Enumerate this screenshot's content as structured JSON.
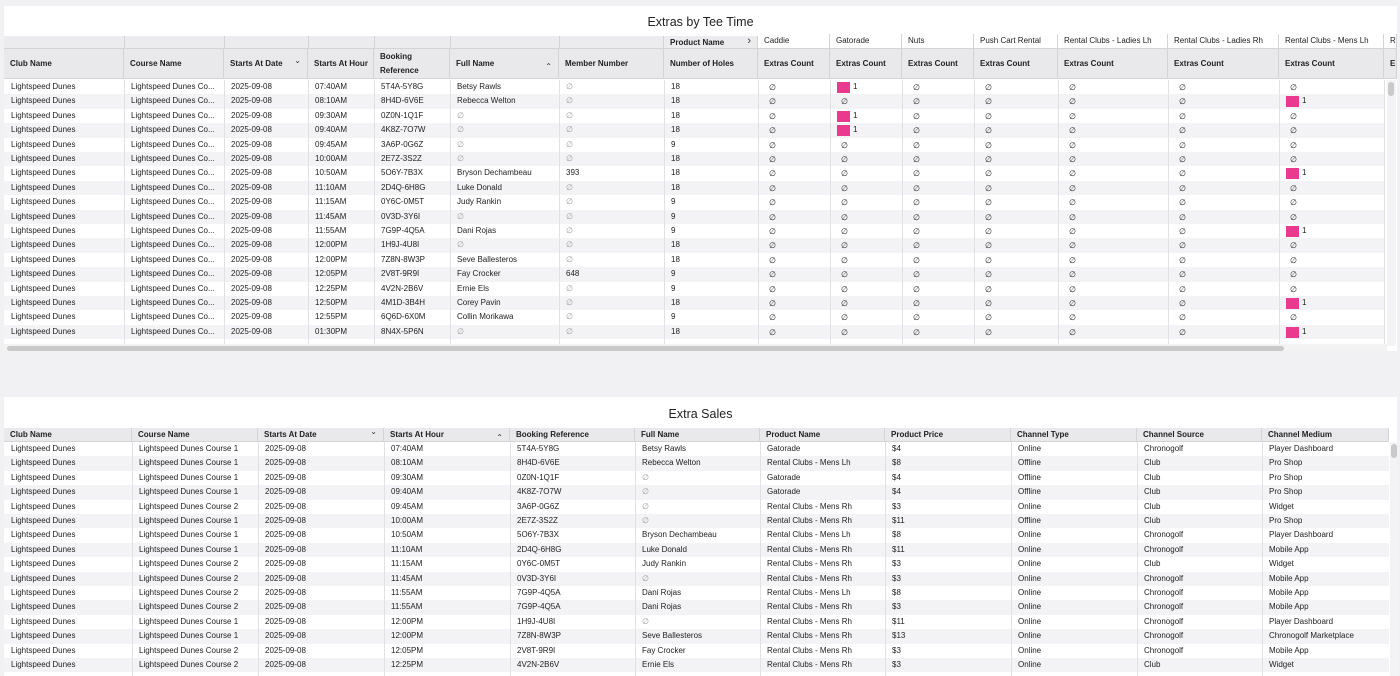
{
  "table1": {
    "title": "Extras by Tee Time",
    "pivot_label": "Product Name",
    "pivot_chevron": "›",
    "columns": [
      "Club Name",
      "Course Name",
      "Starts At Date",
      "Starts At Hour",
      "Booking Reference",
      "Full Name",
      "Member Number",
      "Number of Holes"
    ],
    "booking_line1": "Booking",
    "booking_line2": "Reference",
    "product_groups": [
      "Caddie",
      "Gatorade",
      "Nuts",
      "Push Cart Rental",
      "Rental Clubs - Ladies Lh",
      "Rental Clubs - Ladies Rh",
      "Rental Clubs - Mens Lh",
      "R"
    ],
    "measure_label": "Extras Count",
    "measure_partial": "E",
    "null_symbol": "∅",
    "sort_desc_icon": "⌄",
    "sort_asc_icon": "⌃",
    "rows": [
      [
        "Lightspeed Dunes",
        "Lightspeed Dunes Co...",
        "2025-09-08",
        "07:40AM",
        "5T4A-5Y8G",
        "Betsy Rawls",
        "",
        "18"
      ],
      [
        "Lightspeed Dunes",
        "Lightspeed Dunes Co...",
        "2025-09-08",
        "08:10AM",
        "8H4D-6V6E",
        "Rebecca Welton",
        "",
        "18"
      ],
      [
        "Lightspeed Dunes",
        "Lightspeed Dunes Co...",
        "2025-09-08",
        "09:30AM",
        "0Z0N-1Q1F",
        "",
        "",
        "18"
      ],
      [
        "Lightspeed Dunes",
        "Lightspeed Dunes Co...",
        "2025-09-08",
        "09:40AM",
        "4K8Z-7O7W",
        "",
        "",
        "18"
      ],
      [
        "Lightspeed Dunes",
        "Lightspeed Dunes Co...",
        "2025-09-08",
        "09:45AM",
        "3A6P-0G6Z",
        "",
        "",
        "9"
      ],
      [
        "Lightspeed Dunes",
        "Lightspeed Dunes Co...",
        "2025-09-08",
        "10:00AM",
        "2E7Z-3S2Z",
        "",
        "",
        "18"
      ],
      [
        "Lightspeed Dunes",
        "Lightspeed Dunes Co...",
        "2025-09-08",
        "10:50AM",
        "5O6Y-7B3X",
        "Bryson Dechambeau",
        "393",
        "18"
      ],
      [
        "Lightspeed Dunes",
        "Lightspeed Dunes Co...",
        "2025-09-08",
        "11:10AM",
        "2D4Q-6H8G",
        "Luke Donald",
        "",
        "18"
      ],
      [
        "Lightspeed Dunes",
        "Lightspeed Dunes Co...",
        "2025-09-08",
        "11:15AM",
        "0Y6C-0M5T",
        "Judy Rankin",
        "",
        "9"
      ],
      [
        "Lightspeed Dunes",
        "Lightspeed Dunes Co...",
        "2025-09-08",
        "11:45AM",
        "0V3D-3Y6I",
        "",
        "",
        "9"
      ],
      [
        "Lightspeed Dunes",
        "Lightspeed Dunes Co...",
        "2025-09-08",
        "11:55AM",
        "7G9P-4Q5A",
        "Dani Rojas",
        "",
        "9"
      ],
      [
        "Lightspeed Dunes",
        "Lightspeed Dunes Co...",
        "2025-09-08",
        "12:00PM",
        "1H9J-4U8I",
        "",
        "",
        "18"
      ],
      [
        "Lightspeed Dunes",
        "Lightspeed Dunes Co...",
        "2025-09-08",
        "12:00PM",
        "7Z8N-8W3P",
        "Seve Ballesteros",
        "",
        "18"
      ],
      [
        "Lightspeed Dunes",
        "Lightspeed Dunes Co...",
        "2025-09-08",
        "12:05PM",
        "2V8T-9R9I",
        "Fay Crocker",
        "648",
        "9"
      ],
      [
        "Lightspeed Dunes",
        "Lightspeed Dunes Co...",
        "2025-09-08",
        "12:25PM",
        "4V2N-2B6V",
        "Ernie Els",
        "",
        "9"
      ],
      [
        "Lightspeed Dunes",
        "Lightspeed Dunes Co...",
        "2025-09-08",
        "12:50PM",
        "4M1D-3B4H",
        "Corey Pavin",
        "",
        "18"
      ],
      [
        "Lightspeed Dunes",
        "Lightspeed Dunes Co...",
        "2025-09-08",
        "12:55PM",
        "6Q6D-6X0M",
        "Collin Morikawa",
        "",
        "9"
      ],
      [
        "Lightspeed Dunes",
        "Lightspeed Dunes Co...",
        "2025-09-08",
        "01:30PM",
        "8N4X-5P6N",
        "",
        "",
        "18"
      ]
    ],
    "gatorade_counts": [
      1,
      0,
      1,
      1,
      0,
      0,
      0,
      0,
      0,
      0,
      0,
      0,
      0,
      0,
      0,
      0,
      0,
      0
    ],
    "mens_lh_counts": [
      0,
      1,
      0,
      0,
      0,
      0,
      1,
      0,
      0,
      0,
      1,
      0,
      0,
      0,
      0,
      1,
      0,
      1
    ]
  },
  "table2": {
    "title": "Extra Sales",
    "columns": [
      "Club Name",
      "Course Name",
      "Starts At Date",
      "Starts At Hour",
      "Booking Reference",
      "Full Name",
      "Product Name",
      "Product Price",
      "Channel Type",
      "Channel Source",
      "Channel Medium"
    ],
    "null_symbol": "∅",
    "sort_desc_icon": "⌄",
    "sort_asc_icon": "⌃",
    "rows": [
      [
        "Lightspeed Dunes",
        "Lightspeed Dunes Course 1",
        "2025-09-08",
        "07:40AM",
        "5T4A-5Y8G",
        "Betsy Rawls",
        "Gatorade",
        "$4",
        "Online",
        "Chronogolf",
        "Player Dashboard"
      ],
      [
        "Lightspeed Dunes",
        "Lightspeed Dunes Course 1",
        "2025-09-08",
        "08:10AM",
        "8H4D-6V6E",
        "Rebecca Welton",
        "Rental Clubs - Mens Lh",
        "$8",
        "Offline",
        "Club",
        "Pro Shop"
      ],
      [
        "Lightspeed Dunes",
        "Lightspeed Dunes Course 1",
        "2025-09-08",
        "09:30AM",
        "0Z0N-1Q1F",
        "",
        "Gatorade",
        "$4",
        "Offline",
        "Club",
        "Pro Shop"
      ],
      [
        "Lightspeed Dunes",
        "Lightspeed Dunes Course 1",
        "2025-09-08",
        "09:40AM",
        "4K8Z-7O7W",
        "",
        "Gatorade",
        "$4",
        "Offline",
        "Club",
        "Pro Shop"
      ],
      [
        "Lightspeed Dunes",
        "Lightspeed Dunes Course 2",
        "2025-09-08",
        "09:45AM",
        "3A6P-0G6Z",
        "",
        "Rental Clubs - Mens Rh",
        "$3",
        "Online",
        "Club",
        "Widget"
      ],
      [
        "Lightspeed Dunes",
        "Lightspeed Dunes Course 1",
        "2025-09-08",
        "10:00AM",
        "2E7Z-3S2Z",
        "",
        "Rental Clubs - Mens Rh",
        "$11",
        "Offline",
        "Club",
        "Pro Shop"
      ],
      [
        "Lightspeed Dunes",
        "Lightspeed Dunes Course 1",
        "2025-09-08",
        "10:50AM",
        "5O6Y-7B3X",
        "Bryson Dechambeau",
        "Rental Clubs - Mens Lh",
        "$8",
        "Online",
        "Chronogolf",
        "Player Dashboard"
      ],
      [
        "Lightspeed Dunes",
        "Lightspeed Dunes Course 1",
        "2025-09-08",
        "11:10AM",
        "2D4Q-6H8G",
        "Luke Donald",
        "Rental Clubs - Mens Rh",
        "$11",
        "Online",
        "Chronogolf",
        "Mobile App"
      ],
      [
        "Lightspeed Dunes",
        "Lightspeed Dunes Course 2",
        "2025-09-08",
        "11:15AM",
        "0Y6C-0M5T",
        "Judy Rankin",
        "Rental Clubs - Mens Rh",
        "$3",
        "Online",
        "Club",
        "Widget"
      ],
      [
        "Lightspeed Dunes",
        "Lightspeed Dunes Course 2",
        "2025-09-08",
        "11:45AM",
        "0V3D-3Y6I",
        "",
        "Rental Clubs - Mens Rh",
        "$3",
        "Online",
        "Chronogolf",
        "Mobile App"
      ],
      [
        "Lightspeed Dunes",
        "Lightspeed Dunes Course 2",
        "2025-09-08",
        "11:55AM",
        "7G9P-4Q5A",
        "Dani Rojas",
        "Rental Clubs - Mens Lh",
        "$8",
        "Online",
        "Chronogolf",
        "Mobile App"
      ],
      [
        "Lightspeed Dunes",
        "Lightspeed Dunes Course 2",
        "2025-09-08",
        "11:55AM",
        "7G9P-4Q5A",
        "Dani Rojas",
        "Rental Clubs - Mens Rh",
        "$3",
        "Online",
        "Chronogolf",
        "Mobile App"
      ],
      [
        "Lightspeed Dunes",
        "Lightspeed Dunes Course 1",
        "2025-09-08",
        "12:00PM",
        "1H9J-4U8I",
        "",
        "Rental Clubs - Mens Rh",
        "$11",
        "Online",
        "Chronogolf",
        "Player Dashboard"
      ],
      [
        "Lightspeed Dunes",
        "Lightspeed Dunes Course 1",
        "2025-09-08",
        "12:00PM",
        "7Z8N-8W3P",
        "Seve Ballesteros",
        "Rental Clubs - Mens Rh",
        "$13",
        "Online",
        "Chronogolf",
        "Chronogolf Marketplace"
      ],
      [
        "Lightspeed Dunes",
        "Lightspeed Dunes Course 2",
        "2025-09-08",
        "12:05PM",
        "2V8T-9R9I",
        "Fay Crocker",
        "Rental Clubs - Mens Rh",
        "$3",
        "Online",
        "Chronogolf",
        "Mobile App"
      ],
      [
        "Lightspeed Dunes",
        "Lightspeed Dunes Course 2",
        "2025-09-08",
        "12:25PM",
        "4V2N-2B6V",
        "Ernie Els",
        "Rental Clubs - Mens Rh",
        "$3",
        "Online",
        "Club",
        "Widget"
      ]
    ]
  },
  "colors": {
    "accent_bar": "#ea3a8f",
    "header_bg": "#e9e9ec",
    "alt_row": "#f3f3f5"
  }
}
